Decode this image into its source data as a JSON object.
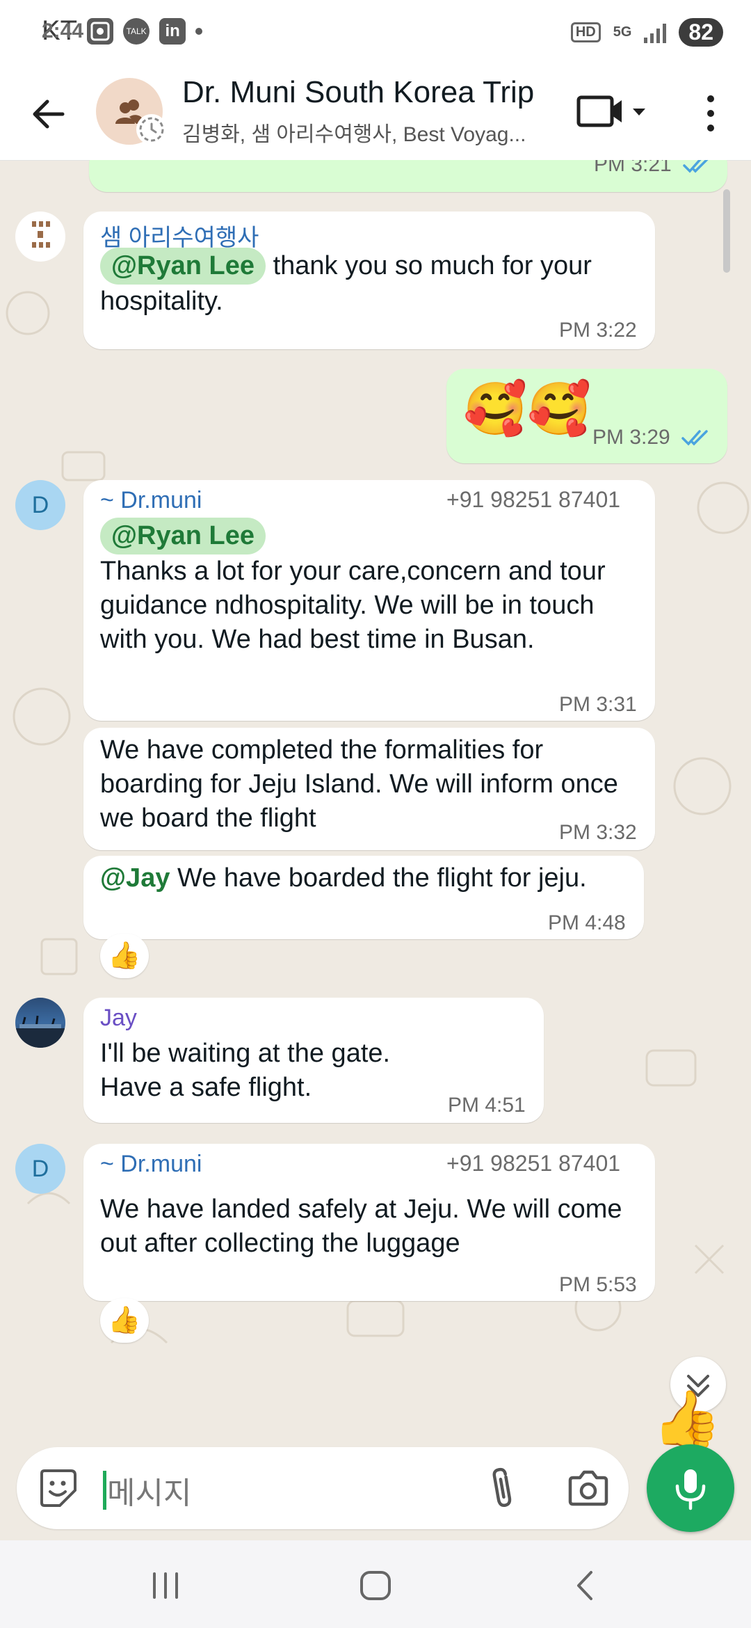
{
  "status_bar": {
    "carrier": "KT",
    "time": "2:44",
    "notif_icons": [
      "screenshot-icon",
      "kakaotalk-icon",
      "linkedin-icon"
    ],
    "talk_label": "TALK",
    "linkedin_label": "in",
    "hd_label": "HD",
    "network_label": "5G",
    "battery": "82"
  },
  "header": {
    "title": "Dr. Muni South Korea Trip",
    "subtitle": "김병화, 샘 아리수여행사, Best Voyag..."
  },
  "messages": [
    {
      "time": "PM 3:21",
      "status": "read"
    },
    {
      "sender": "샘 아리수여행사",
      "sender_color": "#2f6eb5",
      "mention": "@Ryan Lee",
      "text": " thank you so much for your hospitality.",
      "time": "PM 3:22"
    },
    {
      "emoji": "🥰🥰",
      "time": "PM 3:29",
      "status": "read"
    },
    {
      "avatar": "D",
      "sender": "~ Dr.muni",
      "sender_color": "#2f6eb5",
      "phone": "+91 98251 87401",
      "mention": "@Ryan Lee",
      "text": "Thanks a lot for your care,concern and tour guidance  ndhospitality. We will be in touch with you. We had best time in Busan.",
      "time": "PM 3:31"
    },
    {
      "text": "We have completed the formalities for boarding for Jeju Island. We will inform once we board the flight",
      "time": "PM 3:32"
    },
    {
      "mention": "@Jay",
      "text": " We have boarded the flight for jeju.",
      "time": "PM 4:48",
      "reaction": "👍"
    },
    {
      "sender": "Jay",
      "sender_color": "#6a4fc4",
      "text": "I'll be waiting at the gate. Have a safe flight.",
      "time": "PM 4:51"
    },
    {
      "avatar": "D",
      "sender": "~ Dr.muni",
      "sender_color": "#2f6eb5",
      "phone": "+91 98251 87401",
      "text": "We have landed safely at Jeju. We will come out after collecting the luggage",
      "time": "PM 5:53",
      "reaction": "👍"
    }
  ],
  "floating_reaction": "👍",
  "composer": {
    "placeholder": "메시지"
  },
  "colors": {
    "chat_bg": "#efeae2",
    "outgoing": "#d9fdd3",
    "accent": "#1daa61",
    "mention": "#1f7a38"
  }
}
